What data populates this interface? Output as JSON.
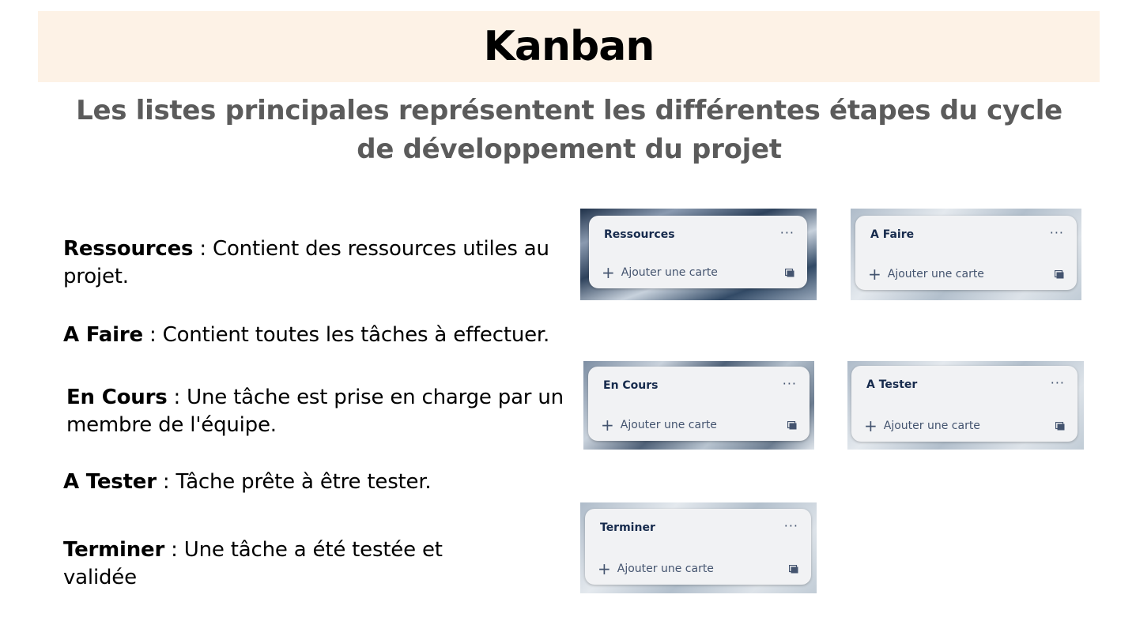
{
  "header": {
    "title": "Kanban"
  },
  "subtitle": "Les listes principales représentent les différentes étapes du cycle de développement du projet",
  "descriptions": [
    {
      "term": "Ressources",
      "text": " : Contient des ressources utiles au projet."
    },
    {
      "term": "A Faire",
      "text": " : Contient toutes les tâches à effectuer."
    },
    {
      "term": "En Cours",
      "text": " : Une tâche est prise en charge par un membre de l'équipe."
    },
    {
      "term": "A Tester",
      "text": " : Tâche prête à être tester."
    },
    {
      "term": "Terminer",
      "text": " : Une tâche a été testée et validée"
    }
  ],
  "lists": [
    {
      "title": "Ressources",
      "menu": "···",
      "add_label": "Ajouter une carte",
      "add_icon": "plus-icon",
      "template_icon": "card-template-icon"
    },
    {
      "title": "A Faire",
      "menu": "···",
      "add_label": "Ajouter une carte",
      "add_icon": "plus-icon",
      "template_icon": "card-template-icon"
    },
    {
      "title": "En Cours",
      "menu": "···",
      "add_label": "Ajouter une carte",
      "add_icon": "plus-icon",
      "template_icon": "card-template-icon"
    },
    {
      "title": "A Tester",
      "menu": "···",
      "add_label": "Ajouter une carte",
      "add_icon": "plus-icon",
      "template_icon": "card-template-icon"
    },
    {
      "title": "Terminer",
      "menu": "···",
      "add_label": "Ajouter une carte",
      "add_icon": "plus-icon",
      "template_icon": "card-template-icon"
    }
  ],
  "colors": {
    "banner": "#fdf2e6",
    "subtitle": "#5b5b5b",
    "card": "#f1f2f4",
    "card_title": "#172b4d"
  }
}
